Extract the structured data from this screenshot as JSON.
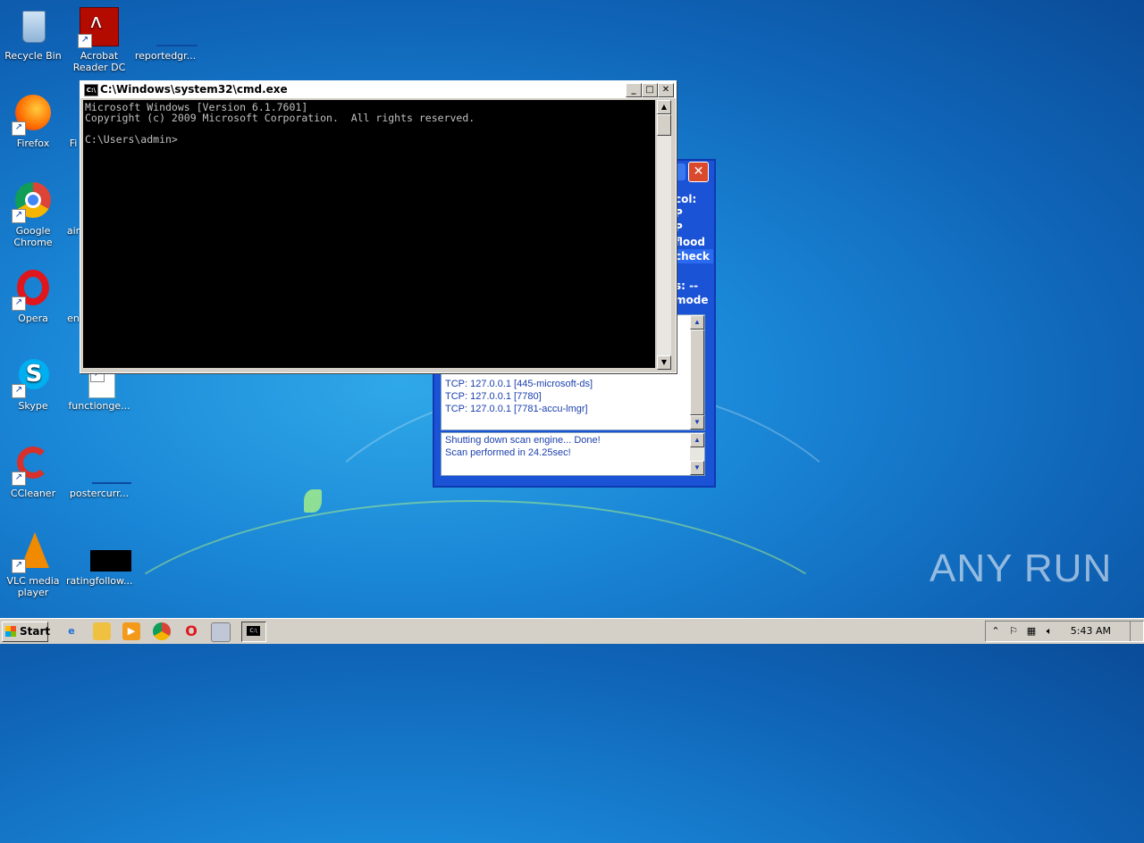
{
  "desktop": {
    "icons": [
      {
        "label": "Recycle Bin",
        "icon": "recycle-bin-icon"
      },
      {
        "label": "Acrobat Reader DC",
        "icon": "acrobat-icon"
      },
      {
        "label": "reportedgr...",
        "icon": "file-icon"
      },
      {
        "label": "Firefox",
        "icon": "firefox-icon"
      },
      {
        "label": "Fi",
        "icon": "file-icon"
      },
      {
        "label": "Google Chrome",
        "icon": "chrome-icon"
      },
      {
        "label": "air",
        "icon": "file-icon"
      },
      {
        "label": "Opera",
        "icon": "opera-icon"
      },
      {
        "label": "en",
        "icon": "file-icon"
      },
      {
        "label": "Skype",
        "icon": "skype-icon"
      },
      {
        "label": "functionge...",
        "icon": "document-icon"
      },
      {
        "label": "CCleaner",
        "icon": "ccleaner-icon"
      },
      {
        "label": "postercurr...",
        "icon": "file-icon"
      },
      {
        "label": "VLC media player",
        "icon": "vlc-icon"
      },
      {
        "label": "ratingfollow...",
        "icon": "file-icon"
      }
    ]
  },
  "cmd": {
    "title": "C:\\Windows\\system32\\cmd.exe",
    "lines": [
      "Microsoft Windows [Version 6.1.7601]",
      "Copyright (c) 2009 Microsoft Corporation.  All rights reserved.",
      "",
      "C:\\Users\\admin>"
    ],
    "minimize": "_",
    "maximize": "□",
    "close": "✕"
  },
  "scanner": {
    "side_labels": [
      "col:",
      "P",
      "P",
      "flood",
      "check",
      "s: --",
      "mode"
    ],
    "results": [
      "TCP: 127.0.0.1 [445-microsoft-ds]",
      "TCP: 127.0.0.1 [7780]",
      "TCP: 127.0.0.1 [7781-accu-lmgr]"
    ],
    "log": [
      "Shutting down scan engine... Done!",
      "Scan performed in 24.25sec!"
    ],
    "close": "✕"
  },
  "taskbar": {
    "start_label": "Start",
    "clock": "5:43 AM"
  },
  "watermark": "ANY RUN"
}
